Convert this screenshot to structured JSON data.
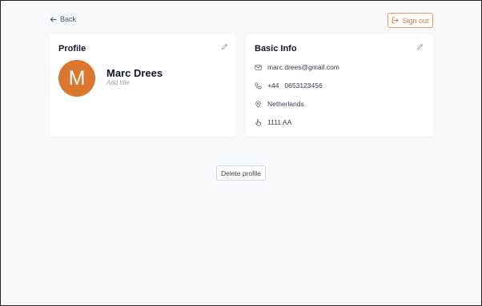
{
  "nav": {
    "back_label": "Back",
    "signout_label": "Sign out"
  },
  "profile": {
    "title": "Profile",
    "avatar_initial": "M",
    "name": "Marc Drees",
    "subtitle_placeholder": "Add title"
  },
  "basic_info": {
    "title": "Basic Info",
    "email": "marc.drees@gmail.com",
    "phone_code": "+44",
    "phone_number": "0653123456",
    "country": "Netherlands",
    "postal_code": "1111 AA"
  },
  "actions": {
    "delete_label": "Delete profile"
  },
  "colors": {
    "accent": "#d9772e",
    "page_bg": "#f8f9fb",
    "card_bg": "#ffffff"
  },
  "icons": {
    "back": "arrow-left-icon",
    "signout": "sign-out-icon",
    "edit": "pencil-icon",
    "email": "mail-icon",
    "phone": "phone-icon",
    "location": "map-pin-icon",
    "postal": "hand-pointer-icon"
  }
}
